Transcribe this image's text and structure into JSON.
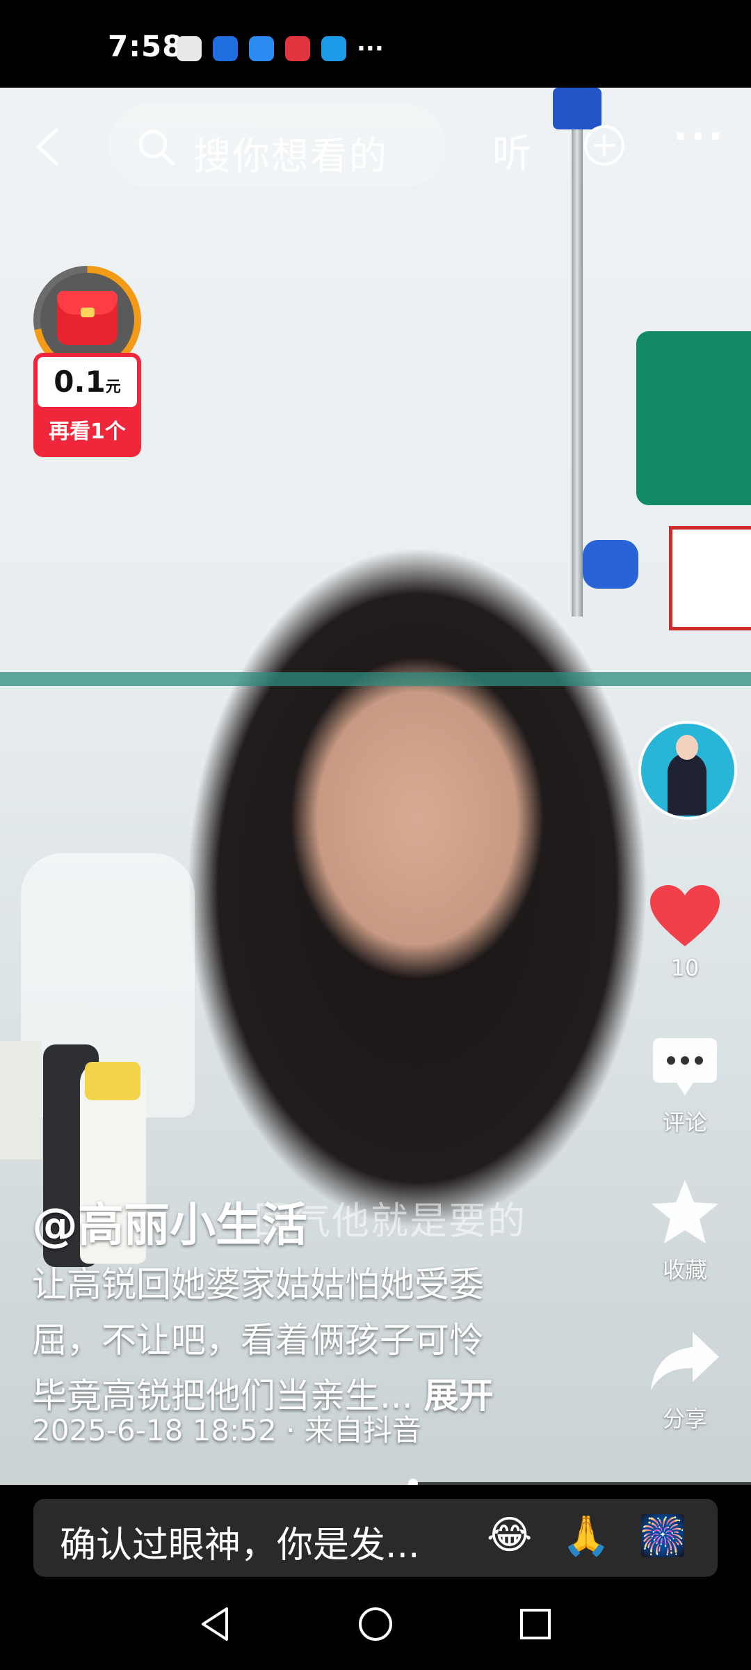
{
  "status_bar": {
    "time": "7:58",
    "more": "···"
  },
  "top_nav": {
    "search_placeholder": "搜你想看的",
    "listen_label": "听"
  },
  "red_packet": {
    "amount": "0.1",
    "unit": "元",
    "cta": "再看1个",
    "progress": 0.72
  },
  "actions": {
    "like_count": "10",
    "comment_label": "评论",
    "favorite_label": "收藏",
    "share_label": "分享"
  },
  "video_overlay_caption": "回气他就是要的",
  "post": {
    "author": "@高丽小生活",
    "description_lines": [
      "让高锐回她婆家姑姑怕她受委",
      "屈，不让吧，看着俩孩子可怜",
      "毕竟高锐把他们当亲生..."
    ],
    "expand_label": "展开",
    "date": "2025-6-18 18:52",
    "source": "来自抖音",
    "separator": "·"
  },
  "playback": {
    "progress": 0.55
  },
  "comment_bar": {
    "placeholder": "确认过眼神，你是发...",
    "emojis": [
      "😂",
      "🙏",
      "🎆"
    ]
  },
  "colors": {
    "like_red": "#f2404b",
    "red_packet": "#f0263a",
    "ring_orange": "#f39a17"
  }
}
